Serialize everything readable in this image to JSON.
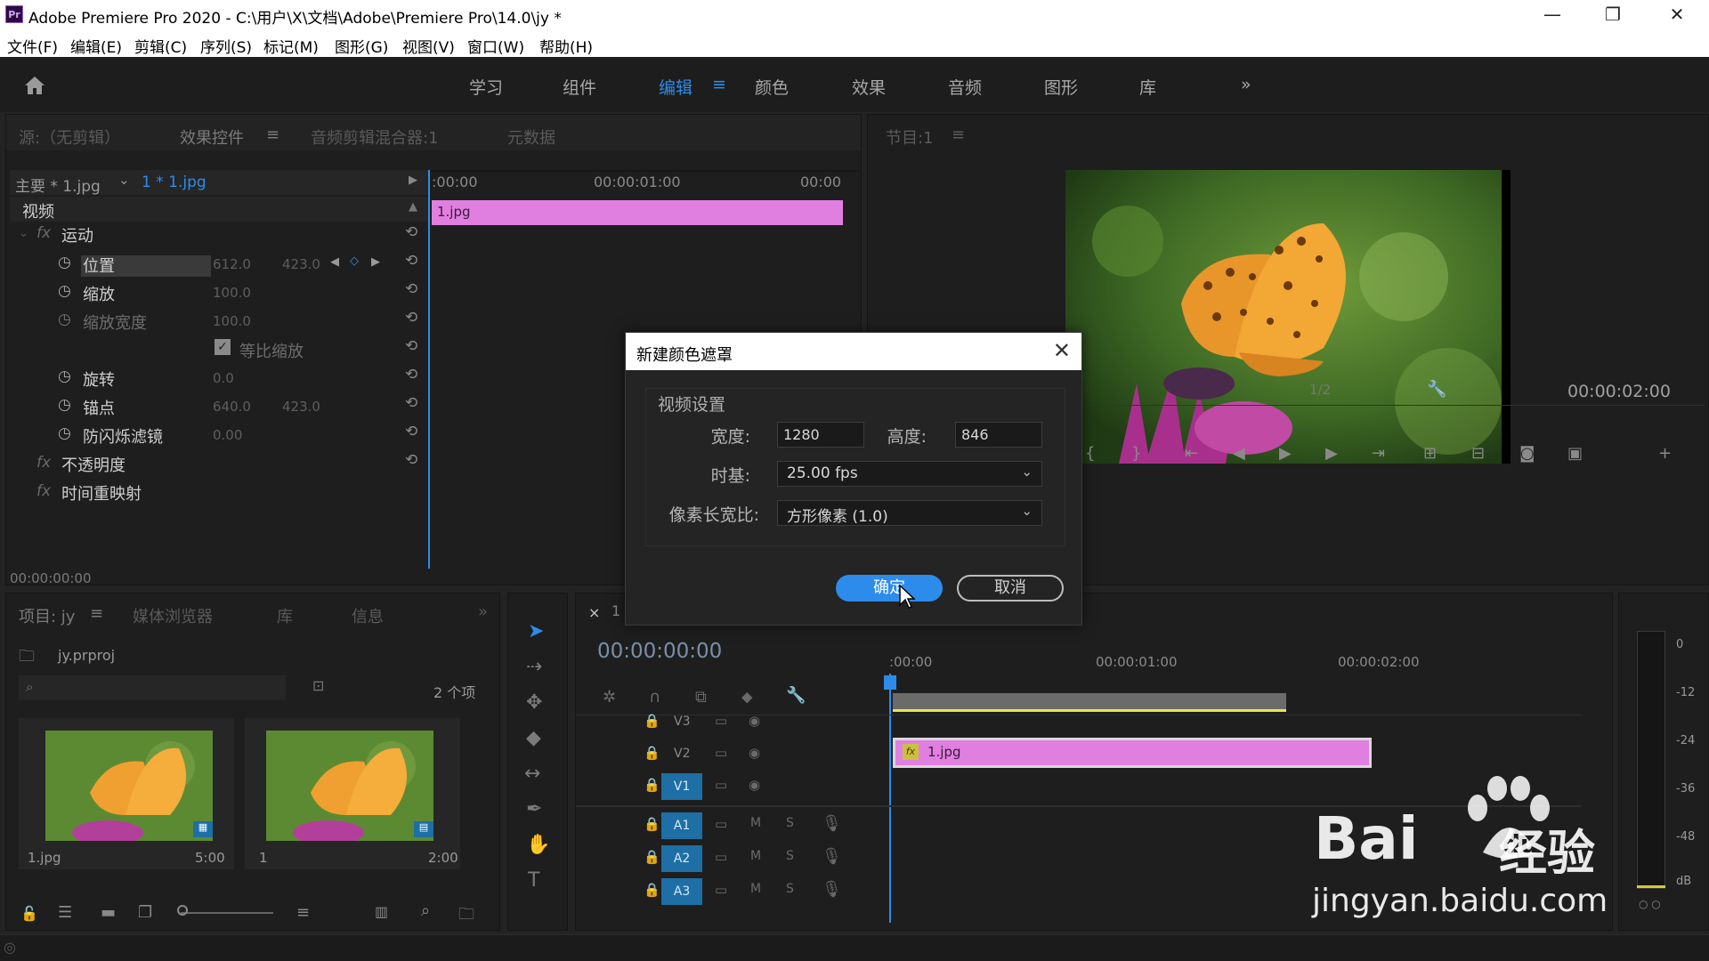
{
  "window": {
    "title": "Adobe Premiere Pro 2020 - C:\\用户\\X\\文档\\Adobe\\Premiere Pro\\14.0\\jy *",
    "logo": "Pr",
    "minimize": "—",
    "restore": "❐",
    "close": "✕"
  },
  "menu": [
    "文件(F)",
    "编辑(E)",
    "剪辑(C)",
    "序列(S)",
    "标记(M)",
    "图形(G)",
    "视图(V)",
    "窗口(W)",
    "帮助(H)"
  ],
  "workspaces": {
    "items": [
      "学习",
      "组件",
      "编辑",
      "颜色",
      "效果",
      "音频",
      "图形",
      "库"
    ],
    "active": "编辑",
    "more": "»",
    "menu_glyph": "≡"
  },
  "source_panel": {
    "tabs": [
      "源:（无剪辑）",
      "效果控件",
      "音频剪辑混合器:1",
      "元数据"
    ],
    "menu_glyph": "≡",
    "master": "主要 * 1.jpg",
    "clip": "1 * 1.jpg",
    "section": "视频",
    "motion": "运动",
    "fx_glyph": "fx",
    "params": [
      {
        "name": "位置",
        "v1": "612.0",
        "v2": "423.0"
      },
      {
        "name": "缩放",
        "v1": "100.0",
        "v2": ""
      },
      {
        "name": "缩放宽度",
        "v1": "100.0",
        "v2": ""
      },
      {
        "name": "等比缩放",
        "v1": "",
        "v2": ""
      },
      {
        "name": "旋转",
        "v1": "0.0",
        "v2": ""
      },
      {
        "name": "锚点",
        "v1": "640.0",
        "v2": "423.0"
      },
      {
        "name": "防闪烁滤镜",
        "v1": "0.00",
        "v2": ""
      }
    ],
    "opacity": "不透明度",
    "time_remap": "时间重映射",
    "ruler": [
      ":00:00",
      "00:00:01:00",
      "00:00"
    ],
    "clip_bar": "1.jpg",
    "timecode": "00:00:00:00"
  },
  "program_panel": {
    "title": "节目:1",
    "menu_glyph": "≡",
    "fraction": "1/2",
    "timecode": "00:00:02:00"
  },
  "dialog": {
    "title": "新建颜色遮罩",
    "section": "视频设置",
    "width_label": "宽度:",
    "width_value": "1280",
    "height_label": "高度:",
    "height_value": "846",
    "timebase_label": "时基:",
    "timebase_value": "25.00 fps",
    "par_label": "像素长宽比:",
    "par_value": "方形像素 (1.0)",
    "ok": "确定",
    "cancel": "取消"
  },
  "project_panel": {
    "tabs": [
      "项目: jy",
      "媒体浏览器",
      "库",
      "信息"
    ],
    "menu_glyph": "≡",
    "more": "»",
    "file": "jy.prproj",
    "count": "2 个项",
    "items": [
      {
        "name": "1.jpg",
        "duration": "5:00"
      },
      {
        "name": "1",
        "duration": "2:00"
      }
    ]
  },
  "timeline": {
    "close": "×",
    "tab": "1",
    "timecode": "00:00:00:00",
    "ruler": [
      ":00:00",
      "00:00:01:00",
      "00:00:02:00"
    ],
    "tracks": [
      {
        "name": "V3",
        "active": false
      },
      {
        "name": "V2",
        "active": false
      },
      {
        "name": "V1",
        "active": true
      },
      {
        "name": "A1",
        "active": true
      },
      {
        "name": "A2",
        "active": true
      },
      {
        "name": "A3",
        "active": true
      }
    ],
    "audio_m": "M",
    "audio_s": "S",
    "clip": "1.jpg",
    "clip_fx": "fx"
  },
  "meter": {
    "labels": [
      "0",
      "-12",
      "-24",
      "-36",
      "-48",
      "dB"
    ]
  },
  "watermark": {
    "brand": "Bai",
    "cn": "经验",
    "url": "jingyan.baidu.com"
  },
  "colors": {
    "accent": "#2d8ceb",
    "clip_pink": "#e07fe0",
    "track_blue": "#1d6fa5"
  }
}
